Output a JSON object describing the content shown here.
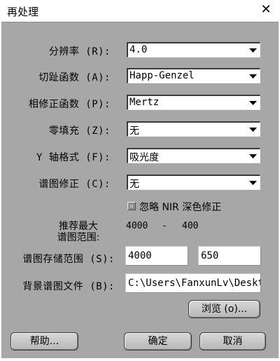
{
  "window": {
    "title": "再处理",
    "close_glyph": "✕"
  },
  "fields": {
    "resolution": {
      "label": "分辨率 (R):",
      "value": "4.0"
    },
    "apodization": {
      "label": "切趾函数 (A):",
      "value": "Happ-Genzel"
    },
    "phase_correction": {
      "label": "相修正函数 (P):",
      "value": "Mertz"
    },
    "zero_filling": {
      "label": "零填充 (Z):",
      "value": "无"
    },
    "y_axis_format": {
      "label": "Y 轴格式 (F):",
      "value": "吸光度"
    },
    "spectrum_correction": {
      "label": "谱图修正 (C):",
      "value": "无"
    }
  },
  "ignore_nir": {
    "label": "忽略 NIR 深色修正",
    "checked": false
  },
  "recommended_range": {
    "label_line1": "推荐最大",
    "label_line2": "谱图范围:",
    "max": "4000",
    "dash": "-",
    "min": "400"
  },
  "storage_range": {
    "label": "谱图存储范围 (S):",
    "from": "4000",
    "to": "650"
  },
  "background_file": {
    "label": "背景谱图文件 (B):",
    "value": "C:\\Users\\FanxunLv\\Desktc"
  },
  "buttons": {
    "browse": "浏览 (o)...",
    "help": "帮助...",
    "ok": "确定",
    "cancel": "取消"
  },
  "icons": {
    "dropdown": "triangle-down-icon",
    "close": "close-icon"
  }
}
